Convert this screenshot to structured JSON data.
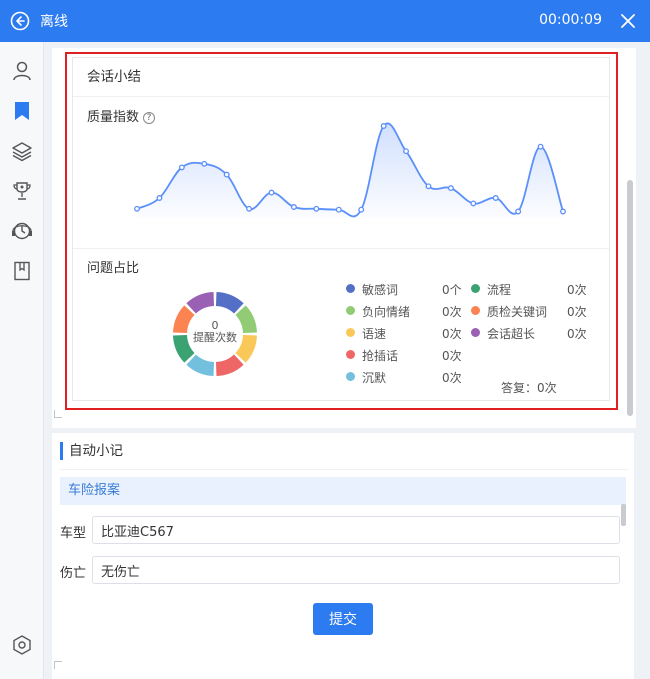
{
  "window": {
    "title": "离线",
    "timer": "00:00:09"
  },
  "sidebar": {
    "items": [
      {
        "icon": "user-icon"
      },
      {
        "icon": "bookmark-icon",
        "active": true
      },
      {
        "icon": "layers-icon"
      },
      {
        "icon": "trophy-icon"
      },
      {
        "icon": "clock-headset-icon"
      },
      {
        "icon": "book-icon"
      }
    ],
    "bottom_icon": "hexagon-settings-icon"
  },
  "summary": {
    "title": "会话小结",
    "quality_label": "质量指数",
    "help_glyph": "?",
    "issues_label": "问题占比",
    "donut_count": "0",
    "donut_label": "提醒次数",
    "reply_label": "答复：0次",
    "legend": [
      {
        "label": "敏感词",
        "count": "0个",
        "color": "#5470c6"
      },
      {
        "label": "负向情绪",
        "count": "0次",
        "color": "#91cc75"
      },
      {
        "label": "语速",
        "count": "0次",
        "color": "#fac858"
      },
      {
        "label": "抢插话",
        "count": "0次",
        "color": "#ee6666"
      },
      {
        "label": "沉默",
        "count": "0次",
        "color": "#73c0de"
      },
      {
        "label": "流程",
        "count": "0次",
        "color": "#3ba272"
      },
      {
        "label": "质检关键词",
        "count": "0次",
        "color": "#fc8452"
      },
      {
        "label": "会话超长",
        "count": "0次",
        "color": "#9a60b4"
      }
    ]
  },
  "chart_data": {
    "type": "area",
    "title": "质量指数",
    "values": [
      0.08,
      0.2,
      0.54,
      0.58,
      0.46,
      0.08,
      0.26,
      0.1,
      0.08,
      0.07,
      0.07,
      1.0,
      0.72,
      0.33,
      0.31,
      0.14,
      0.2,
      0.05,
      0.77,
      0.05
    ],
    "grid": false,
    "color": "#5b8ff9"
  },
  "notes": {
    "title": "自动小记",
    "banner": "车险报案",
    "fields": [
      {
        "label": "车型",
        "value": "比亚迪C567"
      },
      {
        "label": "伤亡",
        "value": "无伤亡"
      }
    ],
    "submit_label": "提交"
  },
  "colors": {
    "accent": "#2d7bf0",
    "highlight_box": "#e02020"
  }
}
